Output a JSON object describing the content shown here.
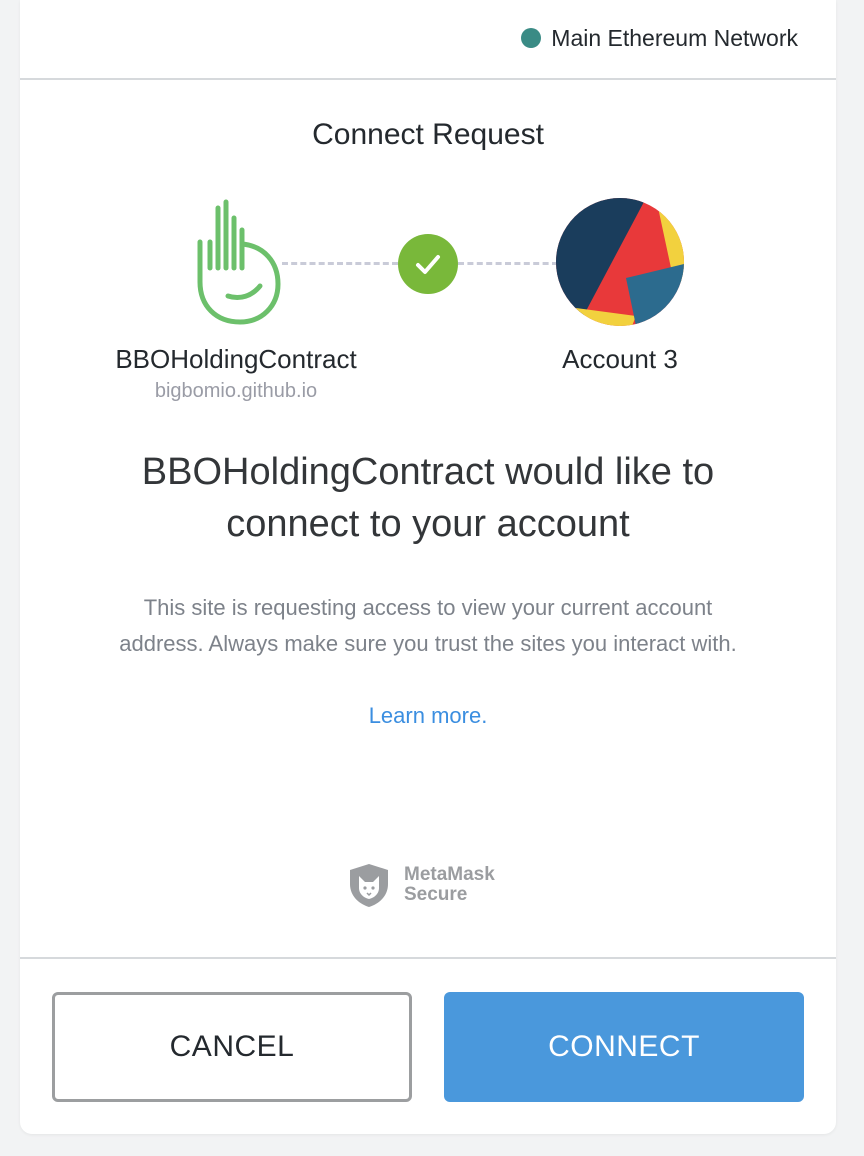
{
  "header": {
    "network_label": "Main Ethereum Network",
    "network_color": "#3a8b85"
  },
  "title": "Connect Request",
  "site": {
    "name": "BBOHoldingContract",
    "url": "bigbomio.github.io",
    "icon": "hand-logo-icon",
    "icon_color": "#6cc06b"
  },
  "status_icon": "checkmark-icon",
  "status_color": "#79b83a",
  "account": {
    "name": "Account 3",
    "avatar_colors": [
      "#1a3d5c",
      "#e8393a",
      "#f2d13e",
      "#2c6b8e"
    ]
  },
  "heading_line1": "BBOHoldingContract would like to",
  "heading_line2": "connect to your account",
  "description": "This site is requesting access to view your current account address. Always make sure you trust the sites you interact with.",
  "learn_more": "Learn more.",
  "badge": {
    "line1": "MetaMask",
    "line2": "Secure",
    "icon": "fox-shield-icon"
  },
  "buttons": {
    "cancel": "CANCEL",
    "connect": "CONNECT",
    "connect_color": "#4a98dc"
  }
}
